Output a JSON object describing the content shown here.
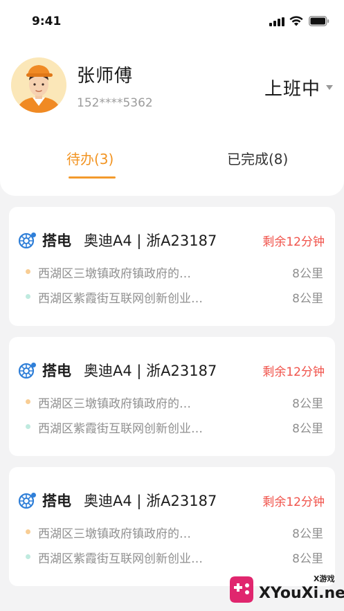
{
  "status_bar": {
    "time": "9:41"
  },
  "profile": {
    "name": "张师傅",
    "phone": "152****5362",
    "work_status": "上班中"
  },
  "tabs": [
    {
      "label": "待办(3)",
      "active": true
    },
    {
      "label": "已完成(8)",
      "active": false
    }
  ],
  "orders": [
    {
      "service": "搭电",
      "vehicle": "奥迪A4 | 浙A23187",
      "remaining": "剩余12分钟",
      "from_address": "西湖区三墩镇政府镇政府的…",
      "from_distance": "8公里",
      "to_address": "西湖区紫霞街互联网创新创业…",
      "to_distance": "8公里"
    },
    {
      "service": "搭电",
      "vehicle": "奥迪A4 | 浙A23187",
      "remaining": "剩余12分钟",
      "from_address": "西湖区三墩镇政府镇政府的…",
      "from_distance": "8公里",
      "to_address": "西湖区紫霞街互联网创新创业…",
      "to_distance": "8公里"
    },
    {
      "service": "搭电",
      "vehicle": "奥迪A4 | 浙A23187",
      "remaining": "剩余12分钟",
      "from_address": "西湖区三墩镇政府镇政府的…",
      "from_distance": "8公里",
      "to_address": "西湖区紫霞街互联网创新创业…",
      "to_distance": "8公里"
    }
  ],
  "watermark": {
    "small_text": "X游戏",
    "big_text": "XYouXi.net"
  },
  "colors": {
    "accent": "#f29422",
    "warning": "#f0524a",
    "icon_blue": "#2f7fd8"
  },
  "icons": {
    "wheel": "wheel-icon",
    "caret": "chevron-down-icon"
  }
}
